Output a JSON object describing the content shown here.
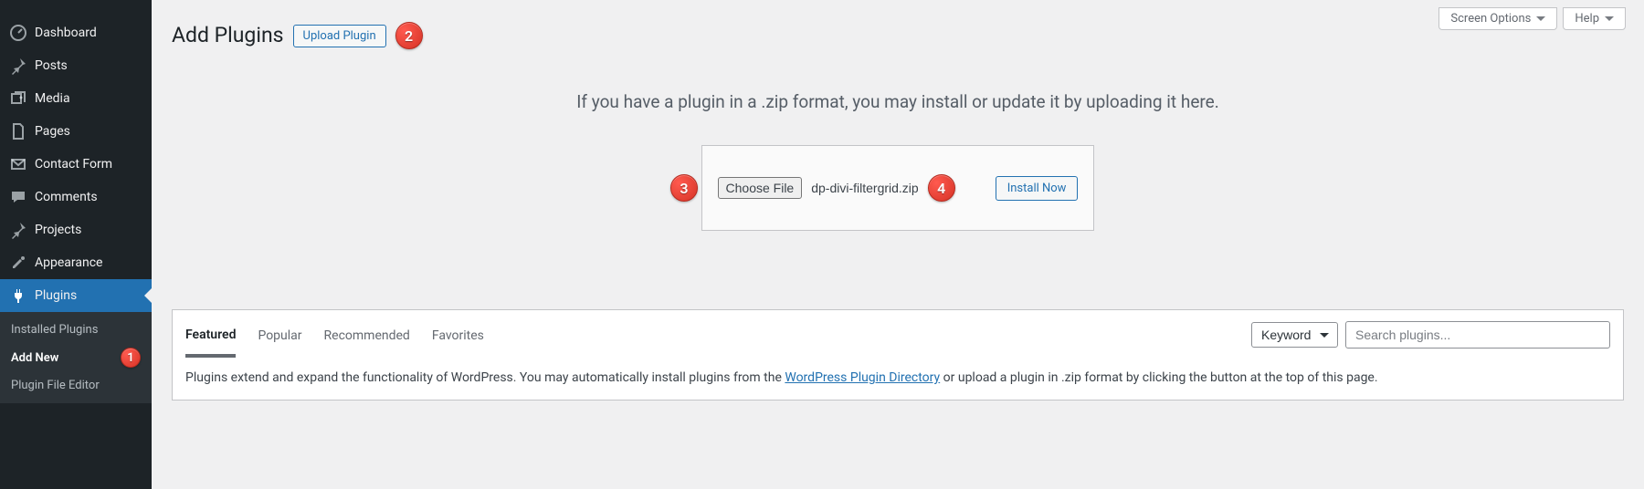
{
  "sidebar": {
    "items": [
      {
        "label": "Dashboard",
        "icon": "dashboard-icon"
      },
      {
        "label": "Posts",
        "icon": "pin-icon"
      },
      {
        "label": "Media",
        "icon": "media-icon"
      },
      {
        "label": "Pages",
        "icon": "page-icon"
      },
      {
        "label": "Contact Form",
        "icon": "mail-icon"
      },
      {
        "label": "Comments",
        "icon": "comment-icon"
      },
      {
        "label": "Projects",
        "icon": "pin-icon"
      },
      {
        "label": "Appearance",
        "icon": "appearance-icon"
      },
      {
        "label": "Plugins",
        "icon": "plugin-icon"
      }
    ],
    "submenu": [
      {
        "label": "Installed Plugins"
      },
      {
        "label": "Add New"
      },
      {
        "label": "Plugin File Editor"
      }
    ]
  },
  "screen_meta": {
    "screen_options": "Screen Options",
    "help": "Help"
  },
  "heading": "Add Plugins",
  "upload_plugin_button": "Upload Plugin",
  "upload_message": "If you have a plugin in a .zip format, you may install or update it by uploading it here.",
  "choose_file_label": "Choose File",
  "selected_filename": "dp-divi-filtergrid.zip",
  "install_now_label": "Install Now",
  "steps": {
    "s1": "1",
    "s2": "2",
    "s3": "3",
    "s4": "4"
  },
  "tabs": {
    "featured": "Featured",
    "popular": "Popular",
    "recommended": "Recommended",
    "favorites": "Favorites"
  },
  "search": {
    "type_label": "Keyword",
    "placeholder": "Search plugins..."
  },
  "desc_prefix": "Plugins extend and expand the functionality of WordPress. You may automatically install plugins from the ",
  "desc_link": "WordPress Plugin Directory",
  "desc_suffix": " or upload a plugin in .zip format by clicking the button at the top of this page."
}
